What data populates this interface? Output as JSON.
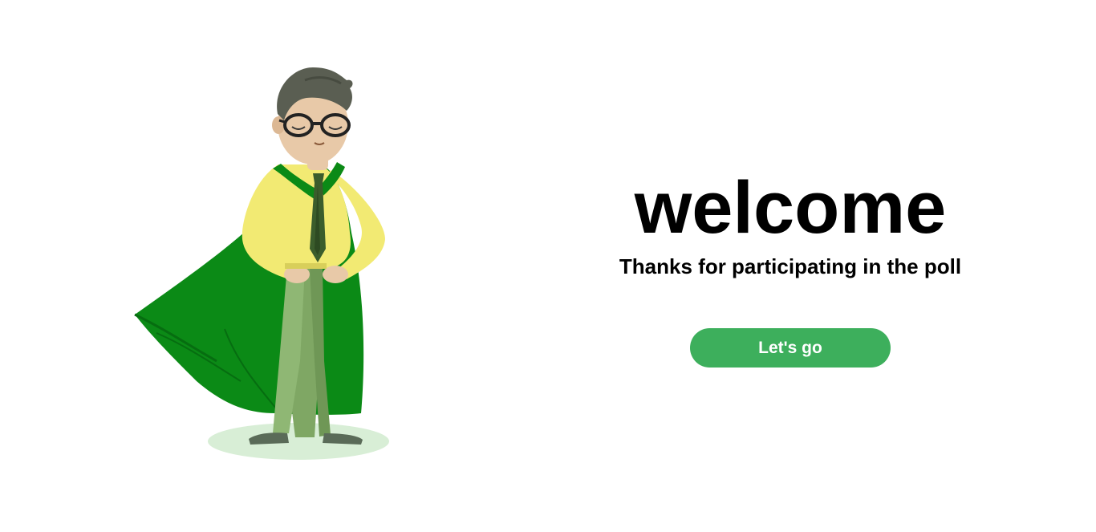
{
  "hero": {
    "title": "welcome",
    "subtitle": "Thanks for participating in the poll",
    "cta_label": "Let's go"
  },
  "illustration": {
    "subject": "superhero-man-icon"
  },
  "colors": {
    "accent": "#3daf5c",
    "cape": "#0b8a16",
    "shirt": "#f2ea73",
    "pants": "#7fa764",
    "shadow": "#d8eed6"
  }
}
